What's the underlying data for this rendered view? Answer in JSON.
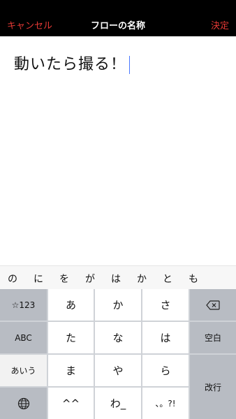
{
  "nav": {
    "cancel_label": "キャンセル",
    "title": "フローの名称",
    "done_label": "決定"
  },
  "editor": {
    "text": "動いたら撮る！"
  },
  "suggestions": [
    "の",
    "に",
    "を",
    "が",
    "は",
    "か",
    "と",
    "も"
  ],
  "keyboard": {
    "left": [
      "☆123",
      "ABC",
      "あいう"
    ],
    "keys": [
      "あ",
      "か",
      "さ",
      "た",
      "な",
      "は",
      "ま",
      "や",
      "ら",
      "^^",
      "わ_",
      "、。?!"
    ],
    "space_label": "空白",
    "enter_label": "改行"
  },
  "colors": {
    "accent": "#e53935",
    "navbar": "#000000",
    "keyboard_bg": "#cfd2d7"
  }
}
